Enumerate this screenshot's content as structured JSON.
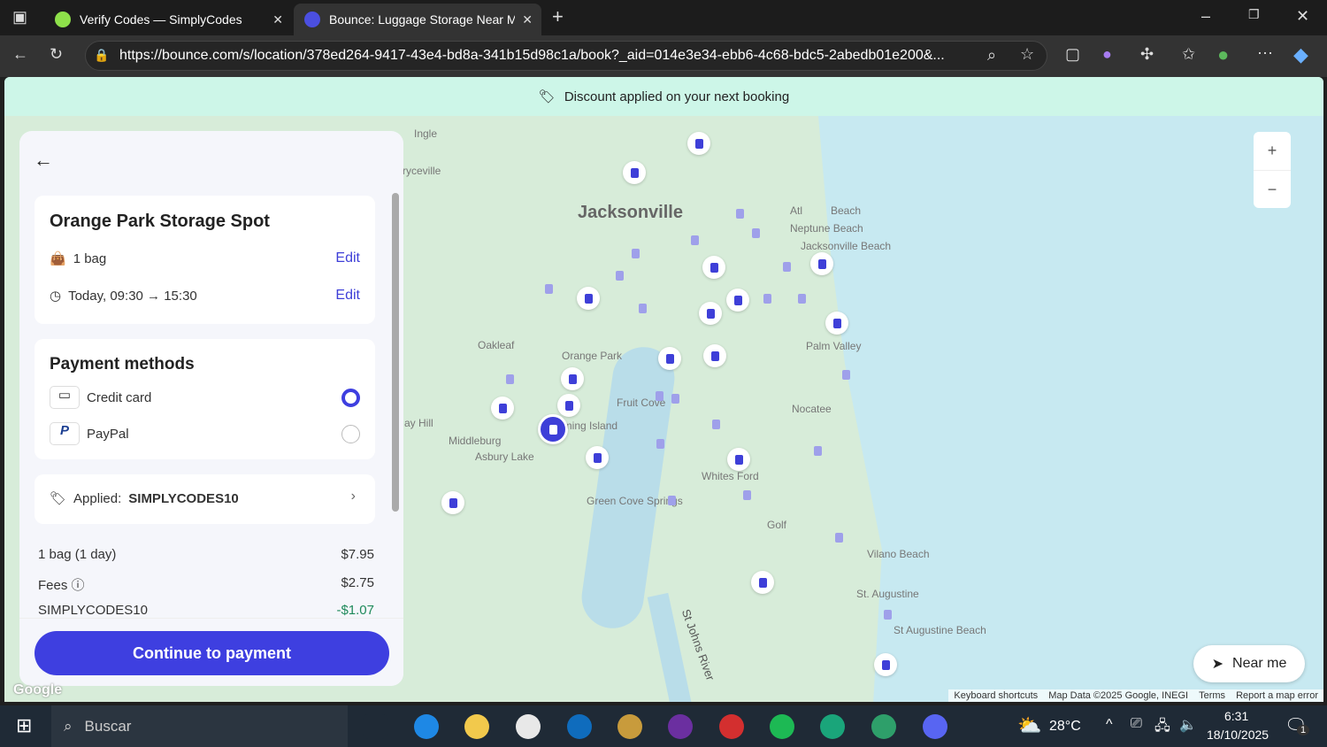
{
  "browser": {
    "tabs": [
      {
        "title": "Verify Codes — SimplyCodes"
      },
      {
        "title": "Bounce: Luggage Storage Near M"
      }
    ],
    "url": "https://bounce.com/s/location/378ed264-9417-43e4-bd8a-341b15d98c1a/book?_aid=014e3e34-ebb6-4c68-bdc5-2abedb01e200&..."
  },
  "banner": {
    "text": "Discount applied on your next booking"
  },
  "booking": {
    "title": "Orange Park Storage Spot",
    "bags": "1 bag",
    "time": "Today, 09:30 → 15:30",
    "edit": "Edit"
  },
  "payment": {
    "title": "Payment methods",
    "methods": [
      {
        "label": "Credit card",
        "selected": true
      },
      {
        "label": "PayPal",
        "selected": false
      }
    ]
  },
  "promo": {
    "label": "Applied:",
    "code": "SIMPLYCODES10"
  },
  "summary": [
    {
      "label": "1 bag (1 day)",
      "value": "$7.95"
    },
    {
      "label": "Fees",
      "value": "$2.75"
    },
    {
      "label": "SIMPLYCODES10",
      "value": "-$1.07"
    }
  ],
  "cta": "Continue to payment",
  "map": {
    "labels": [
      "Jacksonville",
      "Ingle",
      "ryceville",
      "Atl",
      "Beach",
      "Neptune Beach",
      "Jacksonville Beach",
      "Palm Valley",
      "Orange Park",
      "Oakleaf",
      "Fruit Cove",
      "Fleming Island",
      "Middleburg",
      "Asbury Lake",
      "Whites Ford",
      "Green Cove Springs",
      "Nocatee",
      "Vilano Beach",
      "St. Augustine",
      "St Augustine Beach",
      "St Johns River",
      "Golf",
      "ay Hill"
    ],
    "zoom_in": "+",
    "zoom_out": "−",
    "near_me": "Near me",
    "attribution": [
      "Keyboard shortcuts",
      "Map Data ©2025 Google, INEGI",
      "Terms",
      "Report a map error"
    ],
    "google": "Google"
  },
  "taskbar": {
    "search": "Buscar",
    "temp": "28°C",
    "time": "6:31",
    "date": "18/10/2025",
    "notifications": "1"
  },
  "colors": {
    "accent": "#3e3fe0",
    "discount": "#1f8a5b"
  }
}
